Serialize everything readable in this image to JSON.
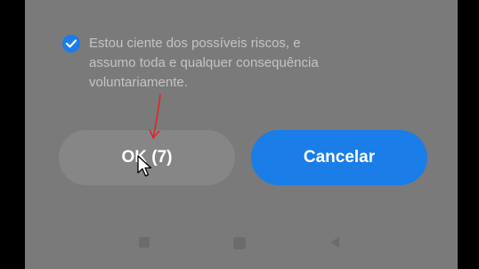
{
  "dialog": {
    "consent": {
      "checked": true,
      "text": "Estou ciente dos possíveis riscos, e\nassumo toda e qualquer consequência\nvoluntariamente."
    },
    "buttons": {
      "ok_label": "OK (7)",
      "cancel_label": "Cancelar"
    }
  },
  "nav_bar": {
    "icons": [
      "square-icon",
      "home-icon",
      "back-icon"
    ]
  },
  "colors": {
    "accent": "#1a7de8",
    "overlay": "#7a7a7a",
    "annotation": "#e0242b"
  }
}
